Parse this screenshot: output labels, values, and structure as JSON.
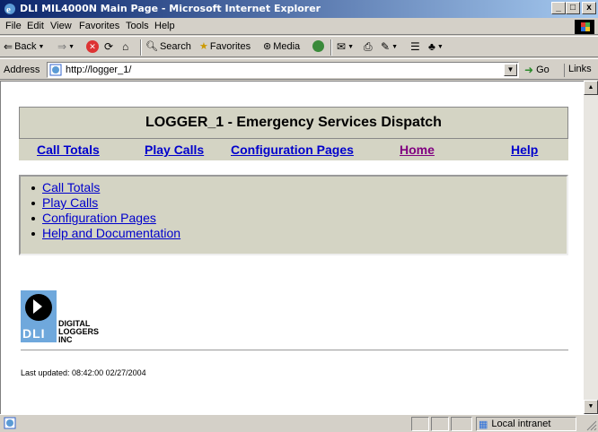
{
  "window": {
    "title": "DLI MIL4000N Main Page - Microsoft Internet Explorer",
    "minimize": "_",
    "maximize": "□",
    "close": "x"
  },
  "menubar": {
    "items": [
      {
        "label": "File"
      },
      {
        "label": "Edit"
      },
      {
        "label": "View"
      },
      {
        "label": "Favorites"
      },
      {
        "label": "Tools"
      },
      {
        "label": "Help"
      }
    ]
  },
  "toolbar": {
    "back": "Back",
    "search": "Search",
    "favorites": "Favorites",
    "media": "Media"
  },
  "address": {
    "label": "Address",
    "url": "http://logger_1/",
    "go": "Go",
    "links": "Links"
  },
  "page": {
    "title": "LOGGER_1 - Emergency Services Dispatch",
    "nav": [
      {
        "label": "Call Totals"
      },
      {
        "label": "Play Calls"
      },
      {
        "label": "Configuration Pages"
      },
      {
        "label": "Home"
      },
      {
        "label": "Help"
      }
    ],
    "menu": [
      {
        "label": "Call Totals"
      },
      {
        "label": "Play Calls"
      },
      {
        "label": "Configuration Pages"
      },
      {
        "label": "Help and Documentation"
      }
    ],
    "logo": {
      "mark": "DLI",
      "line1": "DIGITAL",
      "line2": "LOGGERS",
      "line3": "INC"
    },
    "last_updated": "Last updated: 08:42:00 02/27/2004"
  },
  "statusbar": {
    "zone": "Local intranet"
  },
  "colors": {
    "link": "#0000cc",
    "visited": "#800080",
    "panel": "#d4d4c4",
    "logo_blue": "#6fa8dc"
  }
}
